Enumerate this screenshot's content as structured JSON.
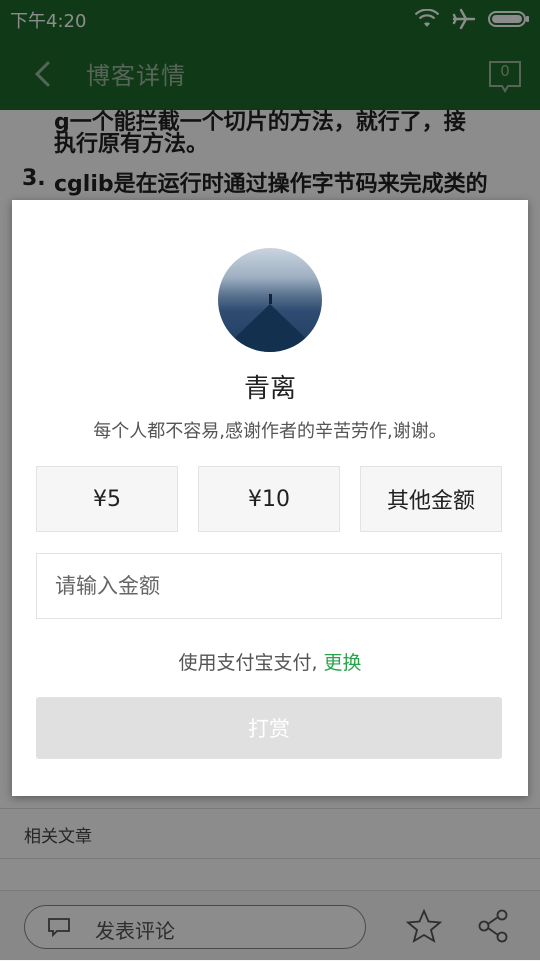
{
  "status_bar": {
    "time": "下午4:20"
  },
  "app_bar": {
    "title": "博客详情",
    "comment_count": "0"
  },
  "article": {
    "line1": "g一个能拦截一个切片的方法，就行了，接",
    "line2": "执行原有方法。",
    "item3_number": "3.",
    "item3_text": "cglib是在运行时通过操作字节码来完成类的",
    "related_label": "相关文章"
  },
  "bottom_bar": {
    "comment_placeholder": "发表评论"
  },
  "dialog": {
    "author_name": "青离",
    "message": "每个人都不容易,感谢作者的辛苦劳作,谢谢。",
    "amounts": [
      "¥5",
      "¥10",
      "其他金额"
    ],
    "amount_placeholder": "请输入金额",
    "payment_prefix": "使用支付宝支付, ",
    "payment_change": "更换",
    "tip_button": "打赏"
  },
  "colors": {
    "brand_green": "#1e6b2a",
    "link_green": "#2aa34a",
    "disabled_button": "#e0e0e0"
  }
}
